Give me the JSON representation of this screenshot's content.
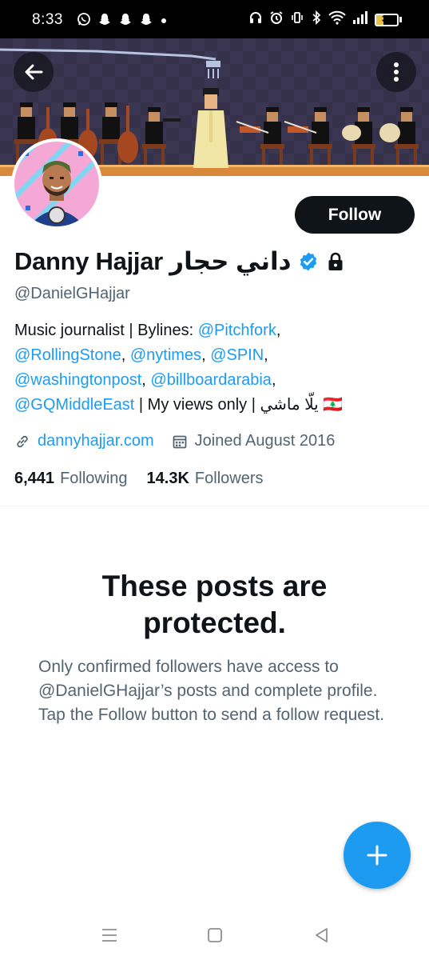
{
  "status_bar": {
    "time": "8:33",
    "battery_level": "36",
    "notification_icons": [
      "whatsapp-icon",
      "snapchat-icon",
      "snapchat-icon",
      "snapchat-icon",
      "dot-icon"
    ],
    "system_icons": [
      "headphones-icon",
      "alarm-icon",
      "vibrate-icon",
      "bluetooth-icon",
      "wifi-icon",
      "signal-icon",
      "battery-icon"
    ]
  },
  "header": {
    "back_icon": "arrow-left-icon",
    "more_icon": "more-vertical-icon"
  },
  "profile": {
    "follow_label": "Follow",
    "display_name": "Danny Hajjar داني حجار",
    "handle": "@DanielGHajjar",
    "bio": {
      "line1_text": "Music journalist | Bylines: ",
      "line1_link": "@Pitchfork",
      "line1_end": ",",
      "line2_link1": "@RollingStone",
      "line2_sep1": ", ",
      "line2_link2": "@nytimes",
      "line2_sep2": ", ",
      "line2_link3": "@SPIN",
      "line2_end": ",",
      "line3_link1": "@washingtonpost",
      "line3_sep": ", ",
      "line3_link2": "@billboardarabia",
      "line3_end": ",",
      "line4_link": "@GQMiddleEast",
      "line4_text": " | My views only | يلّا ماشي 🇱🇧"
    },
    "website": "dannyhajjar.com",
    "joined": "Joined August 2016",
    "following_count": "6,441",
    "following_label": "Following",
    "followers_count": "14.3K",
    "followers_label": "Followers"
  },
  "protected": {
    "title": "These posts are protected.",
    "description": "Only confirmed followers have access to @DanielGHajjar’s posts and complete profile. Tap the Follow button to send a follow request."
  },
  "colors": {
    "accent": "#1d9bf0",
    "text_primary": "#0f1419",
    "text_secondary": "#536471",
    "follow_button": "#0f1419"
  }
}
